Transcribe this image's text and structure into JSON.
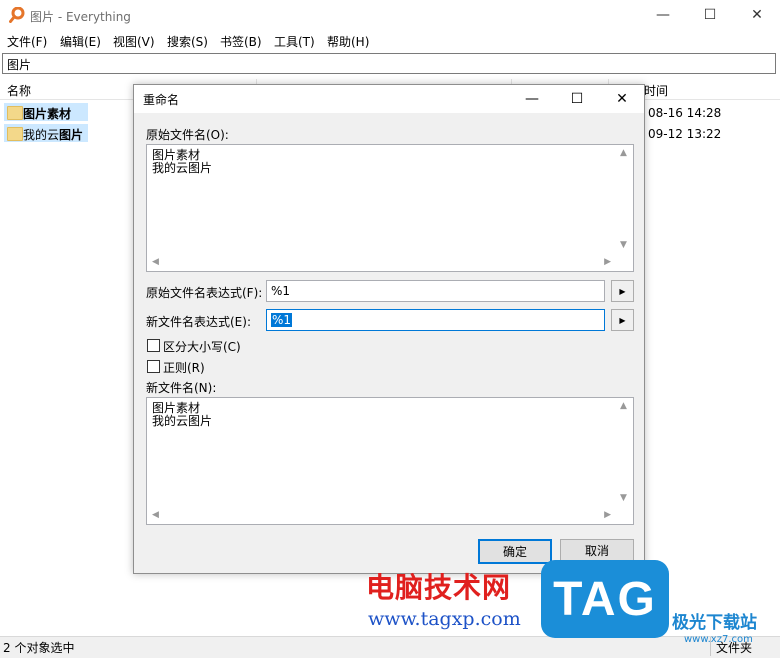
{
  "window": {
    "title": "图片 - Everything",
    "controls": {
      "minimize": "—",
      "maximize": "☐",
      "close": "✕"
    }
  },
  "menu": [
    "文件(F)",
    "编辑(E)",
    "视图(V)",
    "搜索(S)",
    "书签(B)",
    "工具(T)",
    "帮助(H)"
  ],
  "search": {
    "value": "图片"
  },
  "columns": {
    "name": "名称",
    "modified": "时间"
  },
  "rows": [
    {
      "name": "图片素材",
      "date": "08-16 14:28"
    },
    {
      "name_pre": "我的云",
      "name_bold": "图片",
      "date": "09-12 13:22"
    }
  ],
  "status": {
    "text": "2 个对象选中",
    "type_cell": "文件夹"
  },
  "dialog": {
    "title": "重命名",
    "controls": {
      "minimize": "—",
      "maximize": "☐",
      "close": "✕"
    },
    "original_names_label": "原始文件名(O):",
    "original_names": "图片素材\n我的云图片",
    "original_expr_label": "原始文件名表达式(F):",
    "original_expr_value": "%1",
    "new_expr_label": "新文件名表达式(E):",
    "new_expr_value": "%1",
    "case_label": "区分大小写(C)",
    "regex_label": "正则(R)",
    "new_names_label": "新文件名(N):",
    "new_names": "图片素材\n我的云图片",
    "ok_label": "确定",
    "cancel_label": "取消"
  },
  "watermark": {
    "title": "电脑技术网",
    "url": "www.tagxp.com",
    "badge": "TAG",
    "site": "极光下载站",
    "site_url": "www.xz7.com"
  }
}
